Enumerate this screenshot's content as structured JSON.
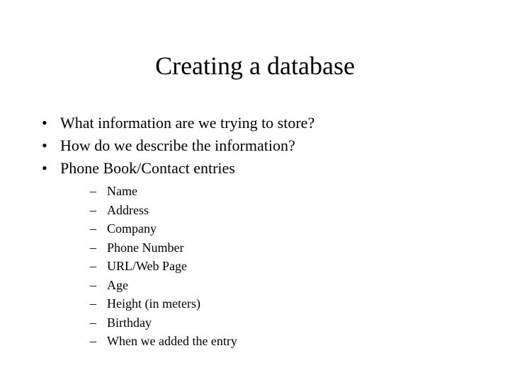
{
  "slide": {
    "title": "Creating a database",
    "background_color": "#ffffff",
    "text_color": "#000000",
    "bullet_marker_level1": "•",
    "bullet_marker_level2": "–",
    "bullets": [
      {
        "text": "What information are we trying to store?"
      },
      {
        "text": "How do we describe the information?"
      },
      {
        "text": "Phone Book/Contact entries"
      }
    ],
    "sub_bullets": [
      {
        "text": "Name"
      },
      {
        "text": "Address"
      },
      {
        "text": "Company"
      },
      {
        "text": "Phone Number"
      },
      {
        "text": "URL/Web Page"
      },
      {
        "text": "Age"
      },
      {
        "text": "Height (in meters)"
      },
      {
        "text": "Birthday"
      },
      {
        "text": "When we added the entry"
      }
    ]
  }
}
